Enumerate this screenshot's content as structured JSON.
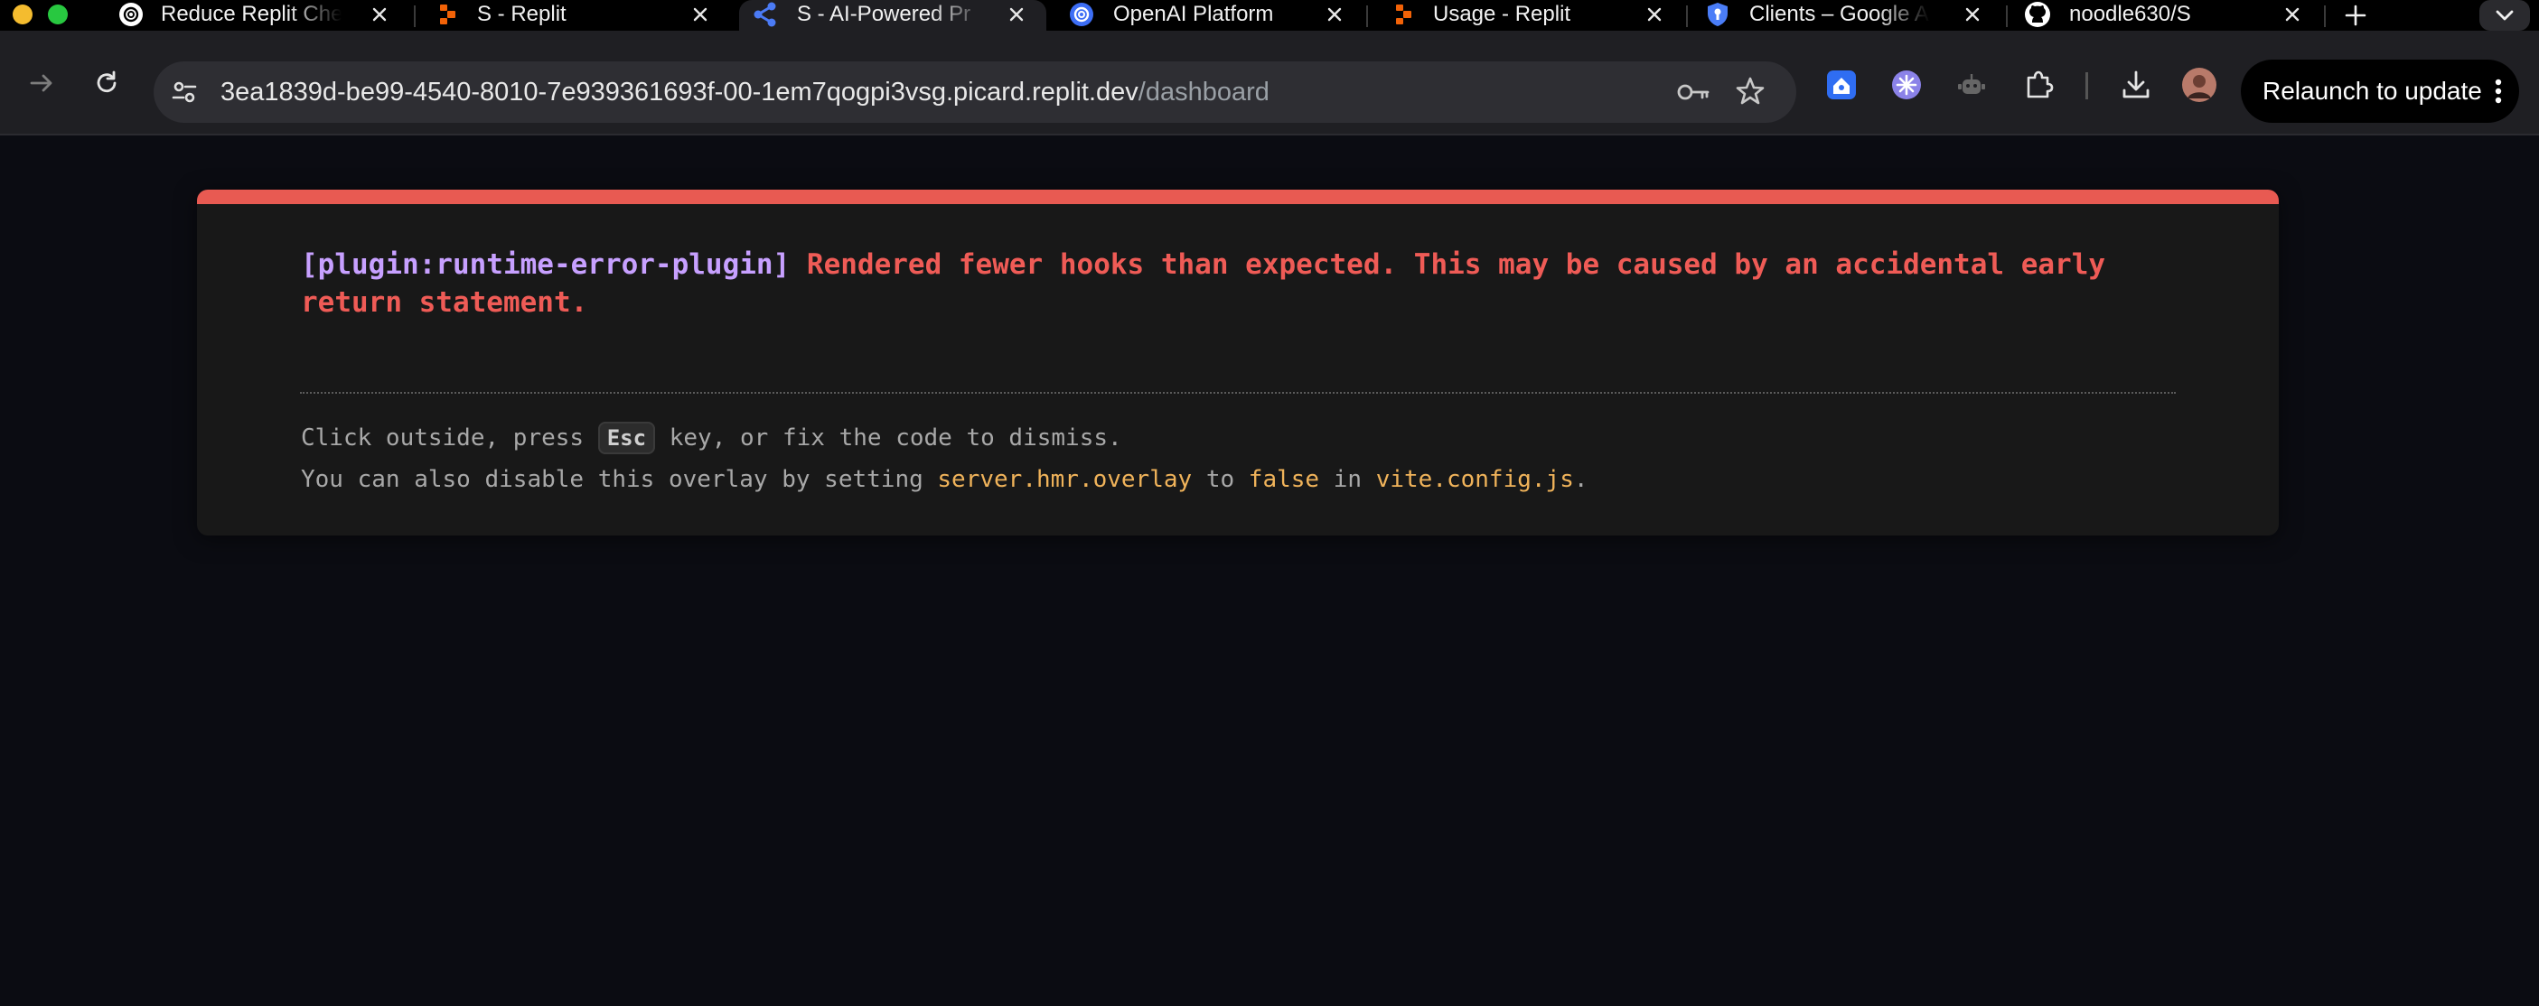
{
  "tabs": [
    {
      "title": "Reduce Replit Che",
      "icon": "openai-icon",
      "active": false
    },
    {
      "title": "S - Replit",
      "icon": "replit-icon",
      "active": false
    },
    {
      "title": "S - AI-Powered Pr",
      "icon": "share-icon",
      "active": true
    },
    {
      "title": "OpenAI Platform",
      "icon": "openai-icon",
      "active": false
    },
    {
      "title": "Usage - Replit",
      "icon": "replit-icon",
      "active": false
    },
    {
      "title": "Clients – Google A",
      "icon": "shield-icon",
      "active": false
    },
    {
      "title": "noodle630/S",
      "icon": "github-icon",
      "active": false
    }
  ],
  "address_bar": {
    "host": "3ea1839d-be99-4540-8010-7e939361693f-00-1em7qogpi3vsg.picard.replit.dev",
    "path": "/dashboard"
  },
  "toolbar": {
    "relaunch_label": "Relaunch to update"
  },
  "overlay": {
    "plugin": "[plugin:runtime-error-plugin]",
    "message": "Rendered fewer hooks than expected. This may be caused by an accidental early return statement.",
    "tip_line1_prefix": "Click outside, press",
    "esc_key": "Esc",
    "tip_line1_suffix": "key, or fix the code to dismiss.",
    "tip_line2_prefix": "You can also disable this overlay by setting",
    "setting_name": "server.hmr.overlay",
    "tip_line2_to": "to",
    "setting_value": "false",
    "tip_line2_in": "in",
    "config_file": "vite.config.js",
    "tip_line2_end": "."
  },
  "colors": {
    "error_accent": "#e85a52",
    "plugin_text": "#c7a0ff",
    "code_highlight": "#f0b35a",
    "page_background": "#0b0c12"
  }
}
